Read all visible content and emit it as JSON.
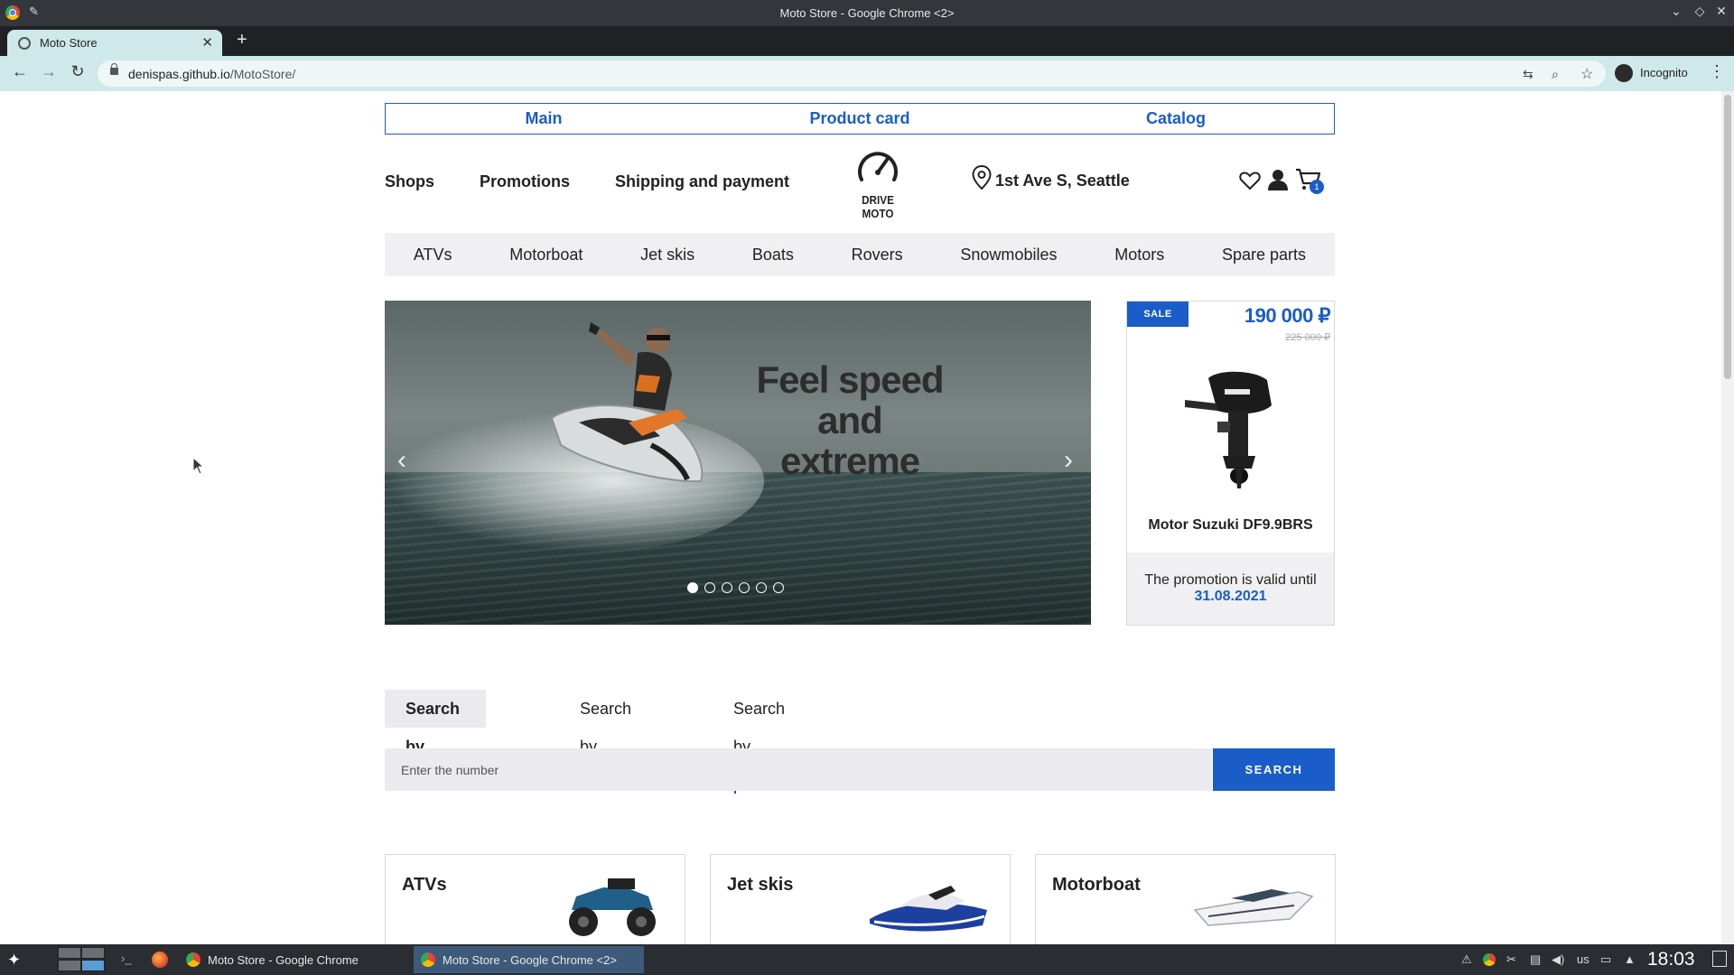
{
  "window": {
    "title": "Moto Store - Google Chrome <2>"
  },
  "browser": {
    "tab_title": "Moto Store",
    "url_host": "denispas.github.io",
    "url_path": "/MotoStore/",
    "profile_label": "Incognito"
  },
  "site": {
    "topnav": [
      "Main",
      "Product card",
      "Catalog"
    ],
    "header_links": [
      "Shops",
      "Promotions",
      "Shipping and payment"
    ],
    "logo_text": "DRIVE MOTO",
    "location": "1st Ave S, Seattle",
    "cart_count": "1",
    "categories": [
      "ATVs",
      "Motorboat",
      "Jet skis",
      "Boats",
      "Rovers",
      "Snowmobiles",
      "Motors",
      "Spare parts"
    ]
  },
  "slider": {
    "headline_lines": [
      "Feel speed",
      "and",
      "extreme"
    ],
    "slide_count": 6,
    "active_slide": 1
  },
  "sale": {
    "badge": "SALE",
    "price": "190 000 ₽",
    "old_price": "225 000 ₽",
    "product_name": "Motor Suzuki DF9.9BRS",
    "promo_text": "The promotion is valid until",
    "promo_date": "31.08.2021"
  },
  "search": {
    "tabs": [
      "Search by number",
      "Search by brand",
      "Search by product"
    ],
    "active_tab": 0,
    "placeholder": "Enter the number",
    "button_label": "SEARCH"
  },
  "cards": [
    "ATVs",
    "Jet skis",
    "Motorboat"
  ],
  "taskbar": {
    "tasks": [
      "Moto Store - Google Chrome",
      "Moto Store - Google Chrome <2>"
    ],
    "keyboard_layout": "us",
    "clock": "18:03"
  },
  "colors": {
    "accent": "#1a5dc8",
    "browser_chrome": "#cfe8ea",
    "titlebar": "#33373b",
    "taskbar": "#2a2d31"
  }
}
